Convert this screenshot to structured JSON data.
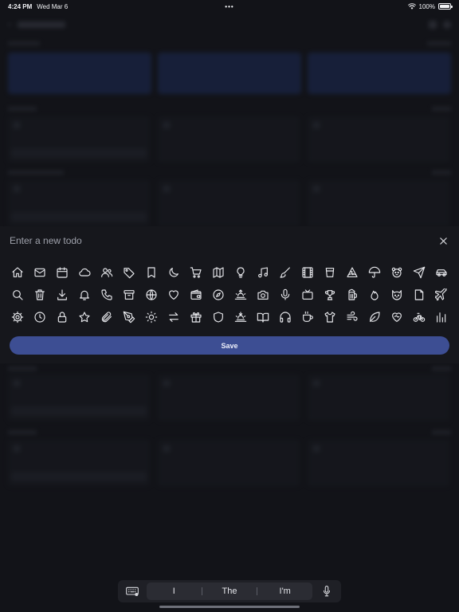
{
  "status_bar": {
    "time": "4:24 PM",
    "date": "Wed Mar 6",
    "center_dots": "•••",
    "battery": "100%",
    "battery_level": 1.0
  },
  "composer": {
    "placeholder": "Enter a new todo",
    "save_label": "Save",
    "icons": [
      "home",
      "mail",
      "calendar",
      "cloud",
      "users",
      "tag",
      "bookmark",
      "moon",
      "cart",
      "map",
      "lightbulb",
      "music",
      "brush",
      "film",
      "cup",
      "pizza",
      "umbrella",
      "bear",
      "send",
      "car",
      "search",
      "trash",
      "download",
      "bell",
      "phone",
      "archive",
      "globe",
      "heart",
      "wallet",
      "compass",
      "sunrise",
      "camera",
      "microphone",
      "tv",
      "trophy",
      "beer",
      "flame",
      "cat",
      "file",
      "airplane",
      "gear",
      "clock",
      "lock",
      "star",
      "paperclip",
      "pen",
      "sun",
      "swap",
      "gift",
      "shield",
      "sunset",
      "book",
      "headphones",
      "coffee",
      "shirt",
      "wind",
      "leaf",
      "heart-handshake",
      "bicycle",
      "chart"
    ]
  },
  "keyboard": {
    "suggestions": [
      "I",
      "The",
      "I'm"
    ]
  },
  "colors": {
    "background": "#121318",
    "sheet": "#16171c",
    "accent": "#3d4e93"
  }
}
